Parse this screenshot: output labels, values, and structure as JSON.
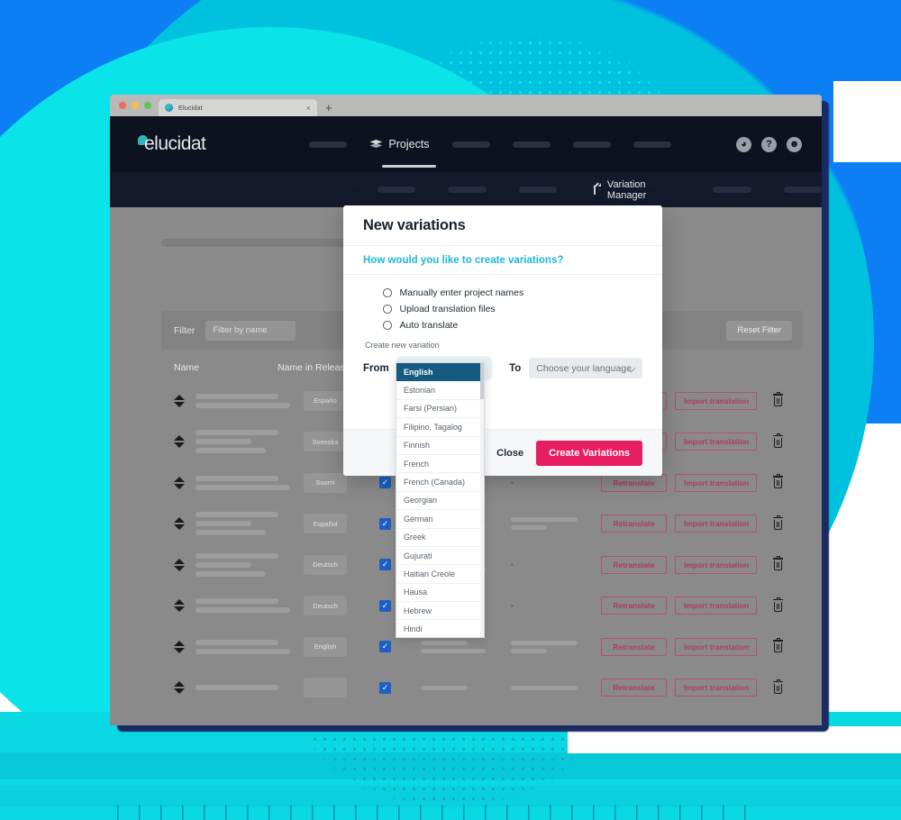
{
  "browser": {
    "tab_title": "Elucidat",
    "tab_close": "×",
    "new_tab": "+"
  },
  "app": {
    "logo_text": "elucidat",
    "nav": {
      "active_item": "Projects",
      "icons": [
        "globe-icon",
        "help-icon",
        "account-icon"
      ],
      "help_glyph": "?"
    },
    "subnav": {
      "active_item": "Variation Manager"
    }
  },
  "filter_bar": {
    "label": "Filter",
    "input_value": "",
    "input_placeholder": "Filter by name",
    "reset_label": "Reset Filter"
  },
  "table": {
    "columns": [
      "Name",
      "Name in Release"
    ],
    "row_actions": {
      "retranslate": "Retranslate",
      "import": "Import translation",
      "delete_icon": "trash-icon"
    },
    "rows": [
      {
        "release_name": "Españo",
        "checked": false,
        "name_lines": 2,
        "col_a_lines": 2,
        "col_b_lines": 2
      },
      {
        "release_name": "Svenska",
        "checked": false,
        "name_lines": 3,
        "col_a_lines": 1,
        "col_b_lines": 0
      },
      {
        "release_name": "Suomi",
        "checked": true,
        "name_lines": 2,
        "col_a_lines": 1,
        "col_b_lines": 0
      },
      {
        "release_name": "Español",
        "checked": true,
        "name_lines": 3,
        "col_a_lines": 2,
        "col_b_lines": 2
      },
      {
        "release_name": "Deutsch",
        "checked": true,
        "name_lines": 3,
        "col_a_lines": 2,
        "col_b_lines": 0
      },
      {
        "release_name": "Deutsch",
        "checked": true,
        "name_lines": 2,
        "col_a_lines": 1,
        "col_b_lines": 0
      },
      {
        "release_name": "English",
        "checked": true,
        "name_lines": 2,
        "col_a_lines": 2,
        "col_b_lines": 2
      },
      {
        "release_name": "",
        "checked": true,
        "name_lines": 1,
        "col_a_lines": 1,
        "col_b_lines": 1
      }
    ]
  },
  "modal": {
    "title": "New variations",
    "subtitle": "How would you like to create variations?",
    "options": [
      {
        "label": "Manually enter project names",
        "selected": false
      },
      {
        "label": "Upload translation files",
        "selected": false
      },
      {
        "label": "Auto translate",
        "selected": false
      }
    ],
    "create_new_variation_label": "Create new variation",
    "from_label": "From",
    "from_value": "English",
    "to_label": "To",
    "to_placeholder": "Choose your language",
    "footer": {
      "close_label": "Close",
      "create_label": "Create Variations"
    }
  },
  "language_dropdown": {
    "selected": "English",
    "options": [
      "English",
      "Estonian",
      "Farsi (Persian)",
      "Filipino, Tagalog",
      "Finnish",
      "French",
      "French (Canada)",
      "Georgian",
      "German",
      "Greek",
      "Gujurati",
      "Haitian Creole",
      "Hausa",
      "Hebrew",
      "Hindi"
    ]
  },
  "colors": {
    "brand_pink": "#e81e63",
    "accent_cyan": "#1fb6d9",
    "nav_dark": "#0c1220",
    "bg_blue": "#0d7ff5",
    "bg_cyan": "#0ae3e8",
    "dropdown_selected": "#175a80",
    "checkbox_blue": "#1d5fc4",
    "outline_button": "#b03a63"
  }
}
